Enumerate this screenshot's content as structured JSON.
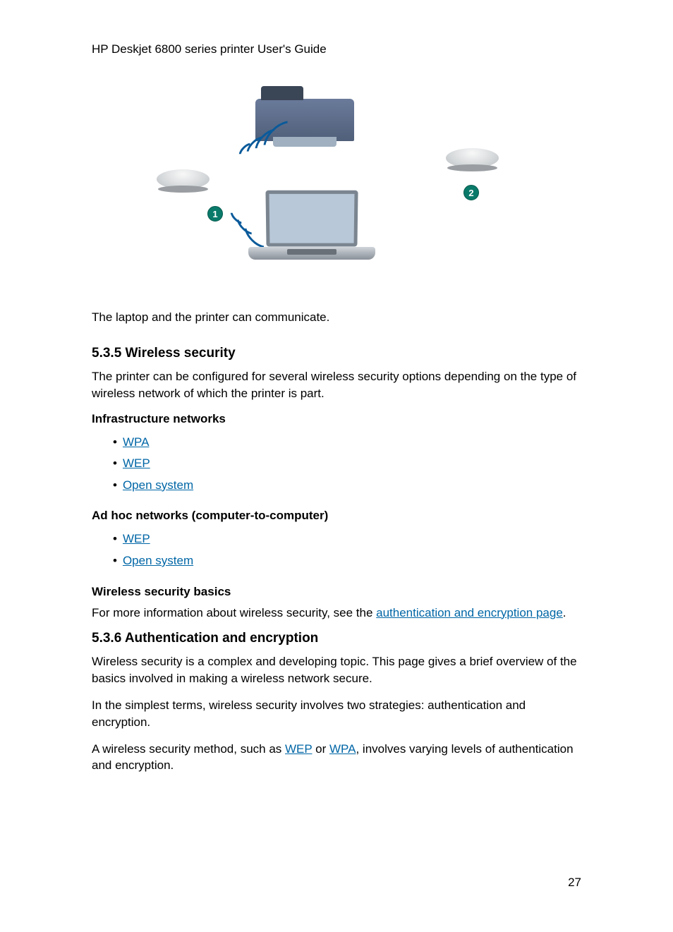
{
  "header": "HP Deskjet 6800 series printer User's Guide",
  "figure": {
    "marker1": "1",
    "marker2": "2",
    "caption": "The laptop and the printer can communicate."
  },
  "section535": {
    "heading": "5.3.5  Wireless security",
    "intro": "The printer can be configured for several wireless security options depending on the type of wireless network of which the printer is part.",
    "infra_heading": "Infrastructure networks",
    "infra_items": {
      "wpa": "WPA",
      "wep": "WEP",
      "open": "Open system"
    },
    "adhoc_heading": "Ad hoc networks (computer-to-computer)",
    "adhoc_items": {
      "wep": "WEP",
      "open": "Open system"
    },
    "basics_heading": "Wireless security basics",
    "basics_pre": "For more information about wireless security, see the ",
    "basics_link": "authentication and encryption page",
    "basics_post": "."
  },
  "section536": {
    "heading": "5.3.6  Authentication and encryption",
    "p1": "Wireless security is a complex and developing topic. This page gives a brief overview of the basics involved in making a wireless network secure.",
    "p2": "In the simplest terms, wireless security involves two strategies: authentication and encryption.",
    "p3_pre": "A wireless security method, such as ",
    "p3_wep": "WEP",
    "p3_mid": " or ",
    "p3_wpa": "WPA",
    "p3_post": ", involves varying levels of authentication and encryption."
  },
  "page_number": "27"
}
